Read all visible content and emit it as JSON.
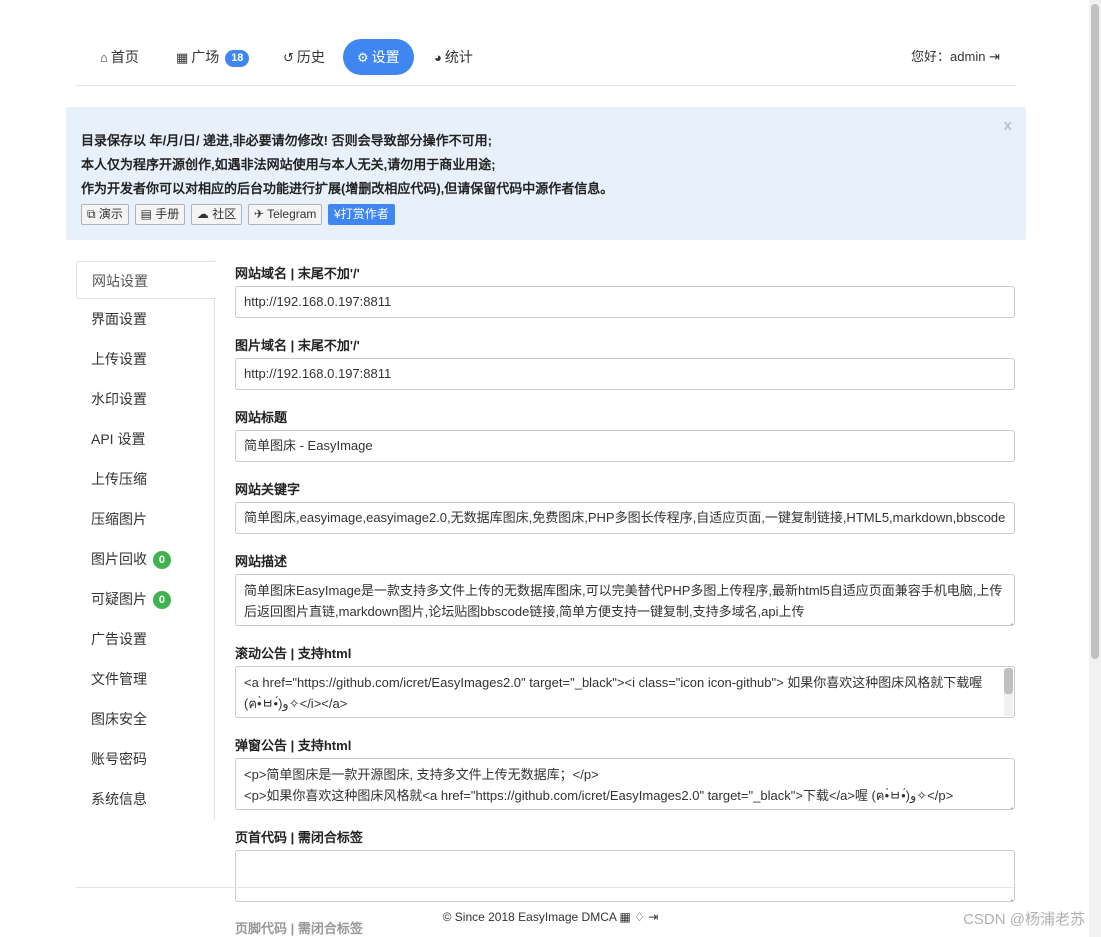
{
  "nav": {
    "items": [
      {
        "label": "首页",
        "icon": "home-icon",
        "glyph": "⌂"
      },
      {
        "label": "广场",
        "icon": "grid-icon",
        "glyph": "▦",
        "badge": "18"
      },
      {
        "label": "历史",
        "icon": "history-icon",
        "glyph": "↺"
      },
      {
        "label": "设置",
        "icon": "gears-icon",
        "glyph": "⚙"
      },
      {
        "label": "统计",
        "icon": "pie-chart-icon",
        "glyph": "◕"
      }
    ],
    "greeting": "您好：admin",
    "logout_glyph": "⇥"
  },
  "alert": {
    "line1": "目录保存以 年/月/日/ 递进,非必要请勿修改! 否则会导致部分操作不可用;",
    "line2": "本人仅为程序开源创作,如遇非法网站使用与本人无关,请勿用于商业用途;",
    "line3": "作为开发者你可以对相应的后台功能进行扩展(增删改相应代码),但请保留代码中源作者信息。",
    "close": "x",
    "buttons": [
      {
        "label": "演示",
        "glyph": "⧉"
      },
      {
        "label": "手册",
        "glyph": "▤"
      },
      {
        "label": "社区",
        "glyph": "☁"
      },
      {
        "label": "Telegram",
        "glyph": "✈"
      },
      {
        "label": "打赏作者",
        "glyph": "¥"
      }
    ]
  },
  "sidebar": {
    "items": [
      {
        "label": "网站设置"
      },
      {
        "label": "界面设置"
      },
      {
        "label": "上传设置"
      },
      {
        "label": "水印设置"
      },
      {
        "label": "API 设置"
      },
      {
        "label": "上传压缩"
      },
      {
        "label": "压缩图片"
      },
      {
        "label": "图片回收",
        "badge": "0"
      },
      {
        "label": "可疑图片",
        "badge": "0"
      },
      {
        "label": "广告设置"
      },
      {
        "label": "文件管理"
      },
      {
        "label": "图床安全"
      },
      {
        "label": "账号密码"
      },
      {
        "label": "系统信息"
      }
    ]
  },
  "form": {
    "domain_label": "网站域名 | 末尾不加'/'",
    "domain_value": "http://192.168.0.197:8811",
    "img_domain_label": "图片域名 | 末尾不加'/'",
    "img_domain_value": "http://192.168.0.197:8811",
    "title_label": "网站标题",
    "title_value": "简单图床 - EasyImage",
    "keywords_label": "网站关键字",
    "keywords_value": "简单图床,easyimage,easyimage2.0,无数据库图床,免费图床,PHP多图长传程序,自适应页面,一键复制链接,HTML5,markdown,bbscode",
    "desc_label": "网站描述",
    "desc_value": "简单图床EasyImage是一款支持多文件上传的无数据库图床,可以完美替代PHP多图上传程序,最新html5自适应页面兼容手机电脑,上传后返回图片直链,markdown图片,论坛贴图bbscode链接,简单方便支持一键复制,支持多域名,api上传",
    "notice_label": "滚动公告 | 支持html",
    "notice_line1": "<a href=\"https://github.com/icret/EasyImages2.0\" target=\"_black\"><i class=\"icon icon-github\"> 如果你喜欢这种图床风格就下载喔",
    "notice_line2": "(ฅ•̀ㅂ•́)و✧</i></a>",
    "popup_label": "弹窗公告 | 支持html",
    "popup_line1": "<p>简单图床是一款开源图床, 支持多文件上传无数据库；</p>",
    "popup_line2": "<p>如果你喜欢这种图床风格就<a href=\"https://github.com/icret/EasyImages2.0\" target=\"_black\">下载</a>喔 (ฅ•̀ㅂ•́)و✧</p>",
    "header_code_label": "页首代码 | 需闭合标签",
    "footer_code_label": "页脚代码 | 需闭合标签"
  },
  "footer": {
    "text": "© Since 2018 EasyImage DMCA",
    "icons": "▦ ♢ ⇥"
  },
  "watermark": "CSDN @杨浦老苏"
}
